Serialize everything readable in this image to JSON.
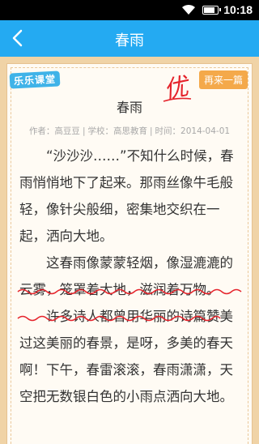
{
  "status_bar": {
    "time": "10:18"
  },
  "app_bar": {
    "title": "春雨"
  },
  "logo": {
    "text": "乐乐课堂"
  },
  "grade_mark": {
    "text": "优"
  },
  "again_button": {
    "label": "再来一篇"
  },
  "essay": {
    "title": "春雨",
    "author_label": "作者：高豆豆",
    "school_label": "学校：高思教育",
    "time_label": "时间：2014-04-01",
    "paragraphs": [
      "“沙沙沙……”不知什么时候，春雨悄悄地下了起来。那雨丝像牛毛般轻，像针尖般细，密集地交织在一起，洒向大地。",
      "这春雨像蒙蒙轻烟，像湿漉漉的云雾，笼罩着大地，滋润着万物。",
      "许多诗人都曾用华丽的诗篇赞美过这美丽的春景，是呀，多美的春天啊！下午，春雷滚滚，春雨潇潇，天空把无数银白色的小雨点洒向大地。"
    ]
  },
  "colors": {
    "app_bar": "#24aaf2",
    "background": "#f0d3a6",
    "paper": "#fffbf4",
    "button": "#f4a94a",
    "mark_red": "#e5232b",
    "squiggle": "#e5232b"
  },
  "icons": {
    "back": "chevron-left-icon",
    "wifi": "wifi-icon",
    "battery": "battery-icon",
    "grade": "grade-mark-icon"
  }
}
